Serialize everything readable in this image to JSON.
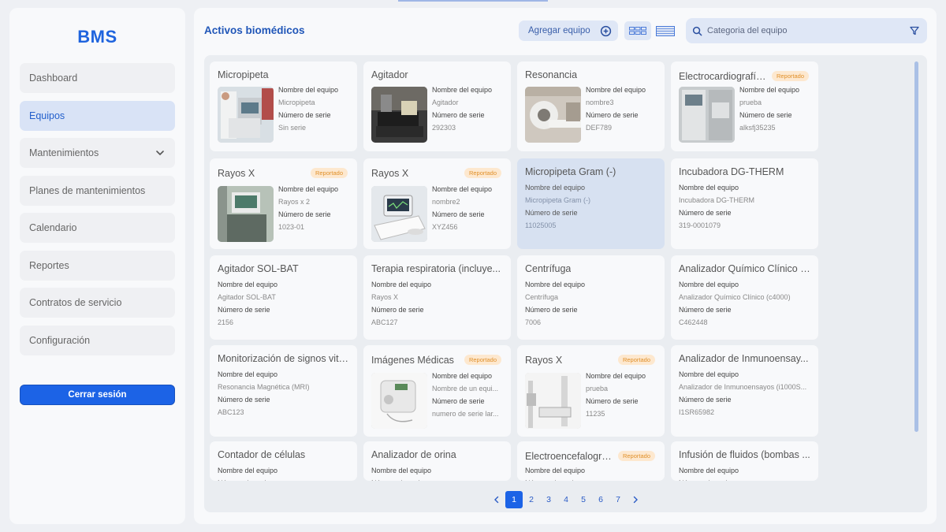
{
  "app": {
    "logo": "BMS"
  },
  "sidebar": {
    "items": [
      {
        "label": "Dashboard",
        "active": false
      },
      {
        "label": "Equipos",
        "active": true
      },
      {
        "label": "Mantenimientos",
        "active": false,
        "expandable": true
      },
      {
        "label": "Planes de mantenimientos",
        "active": false
      },
      {
        "label": "Calendario",
        "active": false
      },
      {
        "label": "Reportes",
        "active": false
      },
      {
        "label": "Contratos de servicio",
        "active": false
      },
      {
        "label": "Configuración",
        "active": false
      }
    ],
    "logout_label": "Cerrar sesión"
  },
  "header": {
    "title": "Activos biomédicos",
    "add_button": "Agregar equipo",
    "search_placeholder": "Categoria del equipo"
  },
  "labels": {
    "name": "Nombre del equipo",
    "serial": "Número de serie",
    "badge": "Reportado"
  },
  "cards": [
    {
      "title": "Micropipeta",
      "name": "Micropipeta",
      "serial": "Sin serie",
      "reported": false
    },
    {
      "title": "Agitador",
      "name": "Agitador",
      "serial": "292303",
      "reported": false
    },
    {
      "title": "Resonancia",
      "name": "nombre3",
      "serial": "DEF789",
      "reported": false
    },
    {
      "title": "Electrocardiografía...",
      "name": "prueba",
      "serial": "alksfj35235",
      "reported": true
    },
    {
      "title": "Rayos X",
      "name": "Rayos x 2",
      "serial": "1023-01",
      "reported": true
    },
    {
      "title": "Rayos X",
      "name": "nombre2",
      "serial": "XYZ456",
      "reported": true
    },
    {
      "title": "Micropipeta Gram (-)",
      "name": "Micropipeta Gram (-)",
      "serial": "11025005",
      "reported": false
    },
    {
      "title": "Incubadora DG-THERM",
      "name": "Incubadora DG-THERM",
      "serial": "319-0001079",
      "reported": false
    },
    {
      "title": "Agitador SOL-BAT",
      "name": "Agitador SOL-BAT",
      "serial": "2156",
      "reported": false
    },
    {
      "title": "Terapia respiratoria (incluye...",
      "name": "Rayos X",
      "serial": "ABC127",
      "reported": false
    },
    {
      "title": "Centrífuga",
      "name": "Centrífuga",
      "serial": "7006",
      "reported": false
    },
    {
      "title": "Analizador Químico Clínico (...",
      "name": "Analizador Químico Clínico (c4000)",
      "serial": "C462448",
      "reported": false
    },
    {
      "title": "Monitorización de signos vita...",
      "name": "Resonancia Magnética (MRI)",
      "serial": "ABC123",
      "reported": false
    },
    {
      "title": "Imágenes Médicas",
      "name": "Nombre de un equi...",
      "serial": "numero de serie lar...",
      "reported": true
    },
    {
      "title": "Rayos X",
      "name": "prueba",
      "serial": "11235",
      "reported": true
    },
    {
      "title": "Analizador de Inmunoensay...",
      "name": "Analizador de Inmunoensayos (i1000S...",
      "serial": "I1SR65982",
      "reported": false
    },
    {
      "title": "Contador de células",
      "name": "",
      "serial": "",
      "reported": false
    },
    {
      "title": "Analizador de orina",
      "name": "",
      "serial": "",
      "reported": false
    },
    {
      "title": "Electroencefalogra...",
      "name": "",
      "serial": "",
      "reported": true
    },
    {
      "title": "Infusión de fluidos (bombas ...",
      "name": "",
      "serial": "",
      "reported": false
    }
  ],
  "pagination": {
    "pages": [
      "1",
      "2",
      "3",
      "4",
      "5",
      "6",
      "7"
    ],
    "current": "1"
  },
  "colors": {
    "accent": "#1c63e6",
    "highlight": "#d7e1f1",
    "badge_bg": "#fde8cf",
    "badge_text": "#e0902a"
  }
}
